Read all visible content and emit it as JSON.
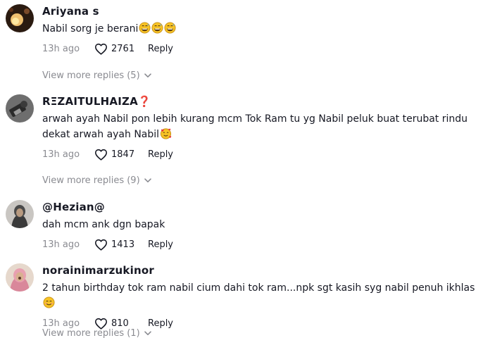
{
  "comments": [
    {
      "username": "Ariyana s",
      "text": "Nabil sorg je berani",
      "emojis": [
        "grinning-sweat",
        "grinning-sweat",
        "grinning-sweat"
      ],
      "time": "13h ago",
      "likes": "2761",
      "reply_label": "Reply",
      "view_more": "View more replies (5)"
    },
    {
      "username": "RΞZAITULHAIZA❓",
      "text": "arwah ayah Nabil pon lebih kurang mcm Tok Ram tu yg Nabil peluk buat terubat rindu dekat arwah ayah Nabil",
      "emojis": [
        "smiling-hearts"
      ],
      "time": "13h ago",
      "likes": "1847",
      "reply_label": "Reply",
      "view_more": "View more replies (9)"
    },
    {
      "username": "@Hezian@",
      "text": "dah mcm ank dgn bapak",
      "emojis": [],
      "time": "13h ago",
      "likes": "1413",
      "reply_label": "Reply",
      "view_more": ""
    },
    {
      "username": "norainimarzukinor",
      "text": "2 tahun birthday tok ram nabil cium dahi tok ram...npk sgt kasih syg nabil penuh ikhlas",
      "emojis": [
        "smiling-blush"
      ],
      "time": "13h ago",
      "likes": "810",
      "reply_label": "Reply",
      "view_more": "View more replies (1)"
    }
  ],
  "colors": {
    "text": "#161823",
    "muted": "#8a8b91",
    "emoji_face": "#f7c325"
  },
  "icons": [
    "heart-outline-icon",
    "chevron-down-icon",
    "grinning-sweat-emoji",
    "smiling-hearts-emoji",
    "smiling-blush-emoji"
  ]
}
